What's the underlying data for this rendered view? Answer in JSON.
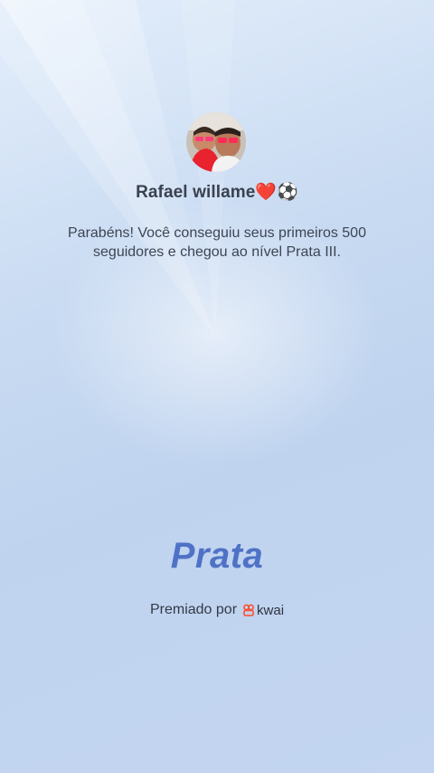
{
  "profile": {
    "username": "Rafael willame❤️⚽",
    "avatar_icon": "profile-photo"
  },
  "message": {
    "line1": "Parabéns! Você conseguiu seus primeiros 500",
    "line2": "seguidores e chegou ao nível Prata III."
  },
  "tier": {
    "label": "Prata",
    "color": "#4f72c6"
  },
  "awarded": {
    "prefix": "Premiado por",
    "brand": "kwai",
    "brand_icon": "kwai-logo-icon",
    "brand_color": "#ff4d2e"
  }
}
